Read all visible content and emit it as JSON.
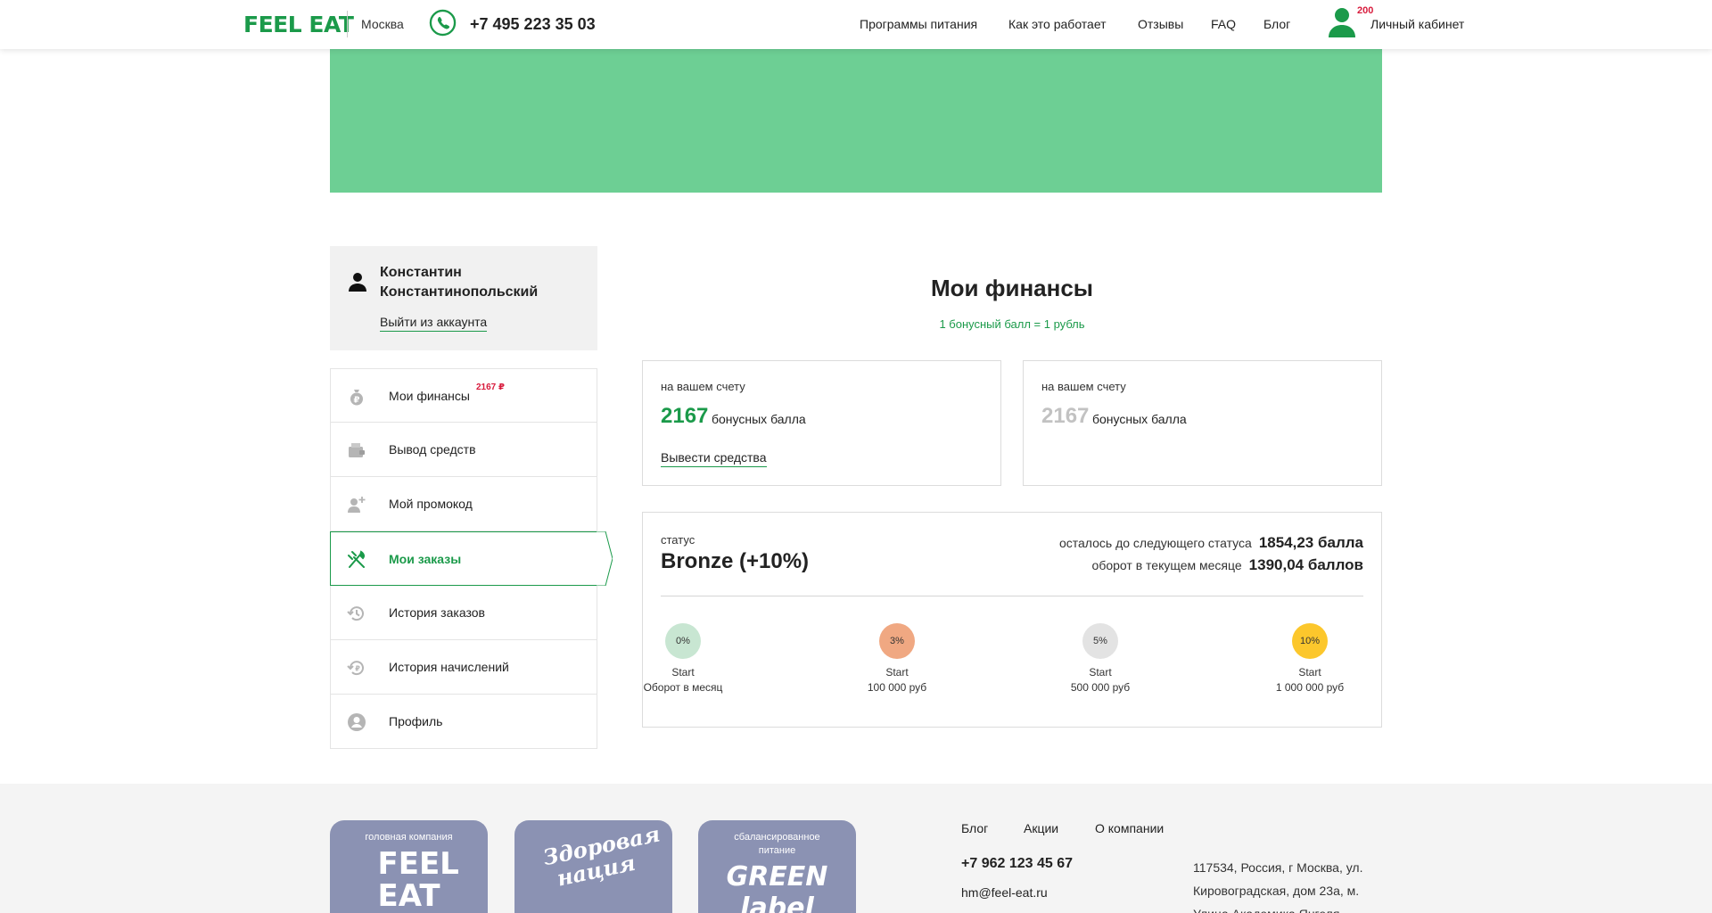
{
  "header": {
    "logo": "FEEL EAT",
    "city": "Москва",
    "phone": "+7 495 223 35 03",
    "nav": [
      "Программы питания",
      "Как это работает",
      "Отзывы",
      "FAQ",
      "Блог"
    ],
    "cabinet_badge": "200",
    "cabinet_label": "Личный кабинет"
  },
  "user": {
    "name": "Константин Константинопольский",
    "logout": "Выйти из аккаунта"
  },
  "menu": [
    {
      "label": "Мои финансы",
      "badge": "2167 ₽",
      "icon": "money-bag-icon"
    },
    {
      "label": "Вывод средств",
      "icon": "wallet-icon"
    },
    {
      "label": "Мой промокод",
      "icon": "add-user-icon"
    },
    {
      "label": "Мои заказы",
      "icon": "fork-knife-icon",
      "active": true
    },
    {
      "label": "История заказов",
      "icon": "history-icon"
    },
    {
      "label": "История начислений",
      "icon": "money-history-icon"
    },
    {
      "label": "Профиль",
      "icon": "profile-icon"
    }
  ],
  "main": {
    "title": "Мои финансы",
    "subtitle": "1 бонусный балл = 1 рубль",
    "card1": {
      "label": "на вашем счету",
      "value": "2167",
      "unit": "бонусных балла",
      "link": "Вывести средства"
    },
    "card2": {
      "label": "на вашем счету",
      "value": "2167",
      "unit": "бонусных балла"
    },
    "status": {
      "label": "статус",
      "value": "Bronze (+10%)",
      "remaining_label": "осталось до следующего статуса",
      "remaining_value": "1854,23 балла",
      "turnover_label": "оборот в текущем месяце",
      "turnover_value": "1390,04 баллов",
      "levels": [
        {
          "pct": "0%",
          "line1": "Start",
          "line2": "Оборот в месяц",
          "color": "#c8e6d2"
        },
        {
          "pct": "3%",
          "line1": "Start",
          "line2": "100 000 руб",
          "color": "#f0a882"
        },
        {
          "pct": "5%",
          "line1": "Start",
          "line2": "500 000 руб",
          "color": "#e3e3e3"
        },
        {
          "pct": "10%",
          "line1": "Start",
          "line2": "1 000 000 руб",
          "color": "#fcc72c"
        }
      ]
    }
  },
  "footer": {
    "brands": [
      {
        "caption": "головная компания",
        "text": "FEEL EAT"
      },
      {
        "caption": "",
        "text": "Здоровая нация"
      },
      {
        "caption": "сбалансированное питание",
        "text": "GREEN label"
      }
    ],
    "links": [
      "Блог",
      "Акции",
      "О компании"
    ],
    "phone": "+7 962 123 45 67",
    "email": "hm@feel-eat.ru",
    "address": "117534, Россия, г Москва, ул. Кировоградская, дом 23а, м. Улица Академика Янгеля"
  },
  "colors": {
    "brand_green": "#1b9a4a",
    "banner_green": "#6dcf94",
    "badge_red": "#d81b3c",
    "brand_card": "#8b92b3"
  }
}
